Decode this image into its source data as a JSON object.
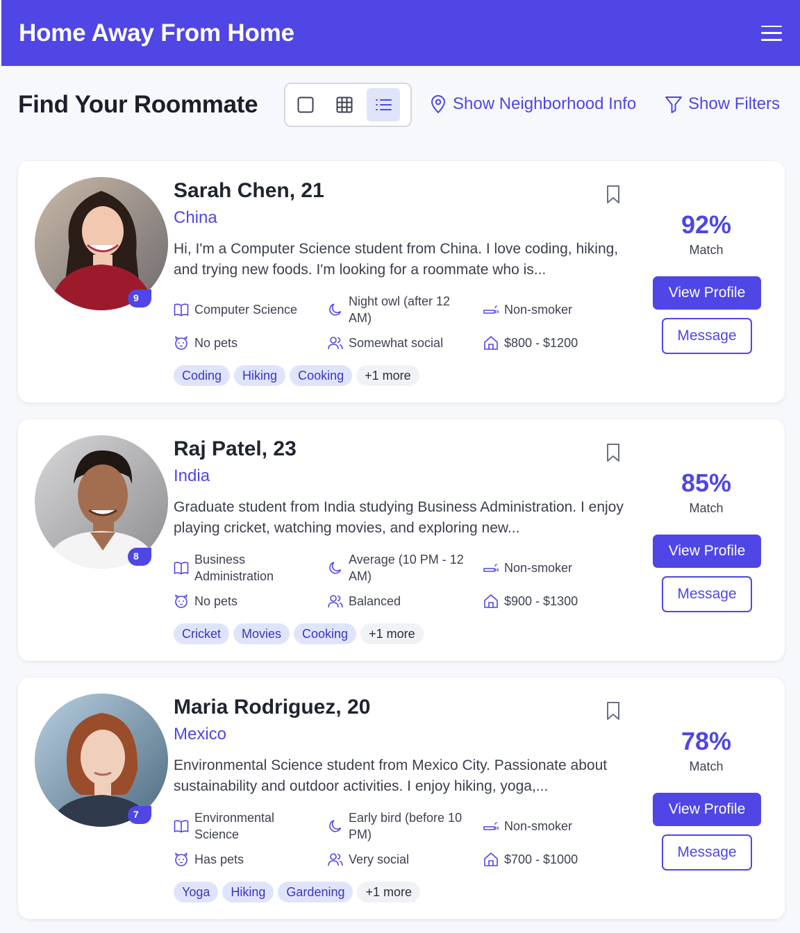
{
  "app": {
    "title": "Home Away From Home"
  },
  "page": {
    "title": "Find Your Roommate"
  },
  "toolbar": {
    "neighborhood_label": "Show Neighborhood Info",
    "filters_label": "Show Filters",
    "active_view": "list"
  },
  "colors": {
    "accent": "#4f46e5",
    "tag_bg": "#e0e4fb",
    "page_bg": "#f7f8fb"
  },
  "profiles": [
    {
      "name": "Sarah Chen, 21",
      "country": "China",
      "bio": "Hi, I'm a Computer Science student from China. I love coding, hiking, and trying new foods. I'm looking for a roommate who is...",
      "major": "Computer Science",
      "sleep": "Night owl (after 12 AM)",
      "smoking": "Non-smoker",
      "pets": "No pets",
      "social": "Somewhat social",
      "budget": "$800 - $1200",
      "tags": [
        "Coding",
        "Hiking",
        "Cooking"
      ],
      "more": "+1 more",
      "match_pct": "92%",
      "match_label": "Match",
      "view_label": "View Profile",
      "message_label": "Message",
      "badge": "9"
    },
    {
      "name": "Raj Patel, 23",
      "country": "India",
      "bio": "Graduate student from India studying Business Administration. I enjoy playing cricket, watching movies, and exploring new...",
      "major": "Business Administration",
      "sleep": "Average (10 PM - 12 AM)",
      "smoking": "Non-smoker",
      "pets": "No pets",
      "social": "Balanced",
      "budget": "$900 - $1300",
      "tags": [
        "Cricket",
        "Movies",
        "Cooking"
      ],
      "more": "+1 more",
      "match_pct": "85%",
      "match_label": "Match",
      "view_label": "View Profile",
      "message_label": "Message",
      "badge": "8"
    },
    {
      "name": "Maria Rodriguez, 20",
      "country": "Mexico",
      "bio": "Environmental Science student from Mexico City. Passionate about sustainability and outdoor activities. I enjoy hiking, yoga,...",
      "major": "Environmental Science",
      "sleep": "Early bird (before 10 PM)",
      "smoking": "Non-smoker",
      "pets": "Has pets",
      "social": "Very social",
      "budget": "$700 - $1000",
      "tags": [
        "Yoga",
        "Hiking",
        "Gardening"
      ],
      "more": "+1 more",
      "match_pct": "78%",
      "match_label": "Match",
      "view_label": "View Profile",
      "message_label": "Message",
      "badge": "7"
    }
  ]
}
